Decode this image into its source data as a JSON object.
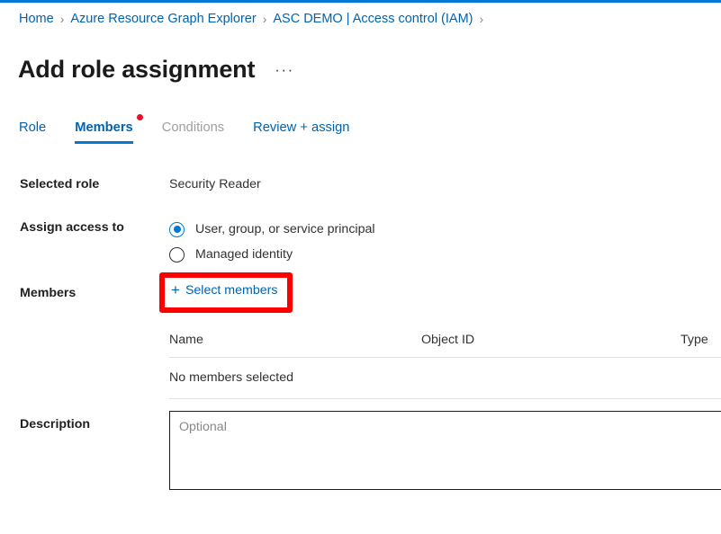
{
  "theme": {
    "accent": "#0078d4",
    "link": "#0063b1",
    "text": "#1b1b1b",
    "muted": "#8a8886",
    "disabled": "#a19f9d",
    "highlight": "#ff0000",
    "badge_red": "#e81123",
    "border": "#e1dfdd"
  },
  "breadcrumb": {
    "separator": "›",
    "items": [
      {
        "label": "Home"
      },
      {
        "label": "Azure Resource Graph Explorer"
      },
      {
        "label": "ASC DEMO | Access control (IAM)"
      }
    ]
  },
  "header": {
    "title": "Add role assignment",
    "more_label": "···"
  },
  "tabs": [
    {
      "label": "Role",
      "state": "enabled",
      "dot": false
    },
    {
      "label": "Members",
      "state": "selected",
      "dot": true
    },
    {
      "label": "Conditions",
      "state": "disabled",
      "dot": false
    },
    {
      "label": "Review + assign",
      "state": "enabled",
      "dot": false
    }
  ],
  "form": {
    "selected_role": {
      "label": "Selected role",
      "value": "Security Reader"
    },
    "assign_access_to": {
      "label": "Assign access to",
      "options": [
        {
          "label": "User, group, or service principal",
          "checked": true
        },
        {
          "label": "Managed identity",
          "checked": false
        }
      ]
    },
    "members": {
      "label": "Members",
      "select_button": {
        "icon": "plus-icon",
        "icon_glyph": "+",
        "label": "Select members"
      },
      "table": {
        "columns": [
          "Name",
          "Object ID",
          "Type"
        ],
        "empty_message": "No members selected",
        "rows": []
      }
    },
    "description": {
      "label": "Description",
      "value": "",
      "placeholder": "Optional"
    }
  }
}
